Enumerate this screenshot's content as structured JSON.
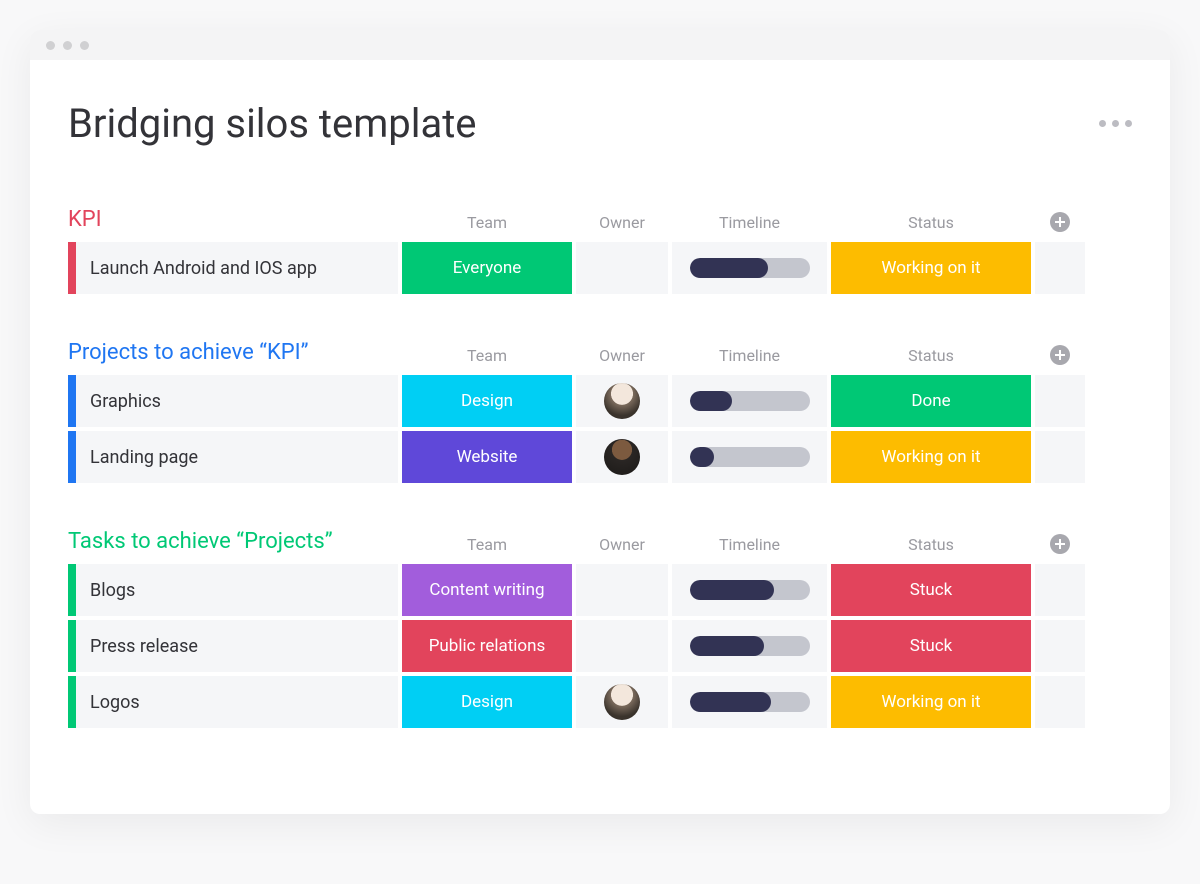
{
  "page_title": "Bridging silos template",
  "columns": {
    "team": "Team",
    "owner": "Owner",
    "timeline": "Timeline",
    "status": "Status"
  },
  "team_colors": {
    "Everyone": "#00c875",
    "Design": "#00cff4",
    "Website": "#5f48d9",
    "Content writing": "#a25ddc",
    "Public relations": "#e2445c"
  },
  "status_colors": {
    "Working on it": "#fdbc00",
    "Done": "#00c875",
    "Stuck": "#e2445c"
  },
  "groups": [
    {
      "title": "KPI",
      "color": "#e2445c",
      "rows": [
        {
          "name": "Launch Android and IOS app",
          "team": "Everyone",
          "owner": "",
          "timeline_pct": 65,
          "status": "Working on it"
        }
      ]
    },
    {
      "title": "Projects to achieve “KPI”",
      "color": "#1f76f2",
      "rows": [
        {
          "name": "Graphics",
          "team": "Design",
          "owner": "a1",
          "timeline_pct": 35,
          "status": "Done"
        },
        {
          "name": "Landing page",
          "team": "Website",
          "owner": "a2",
          "timeline_pct": 20,
          "status": "Working on it"
        }
      ]
    },
    {
      "title": "Tasks to achieve “Projects”",
      "color": "#00c875",
      "rows": [
        {
          "name": "Blogs",
          "team": "Content writing",
          "owner": "",
          "timeline_pct": 70,
          "status": "Stuck"
        },
        {
          "name": "Press release",
          "team": "Public relations",
          "owner": "",
          "timeline_pct": 62,
          "status": "Stuck"
        },
        {
          "name": "Logos",
          "team": "Design",
          "owner": "a3",
          "timeline_pct": 68,
          "status": "Working on it"
        }
      ]
    }
  ]
}
